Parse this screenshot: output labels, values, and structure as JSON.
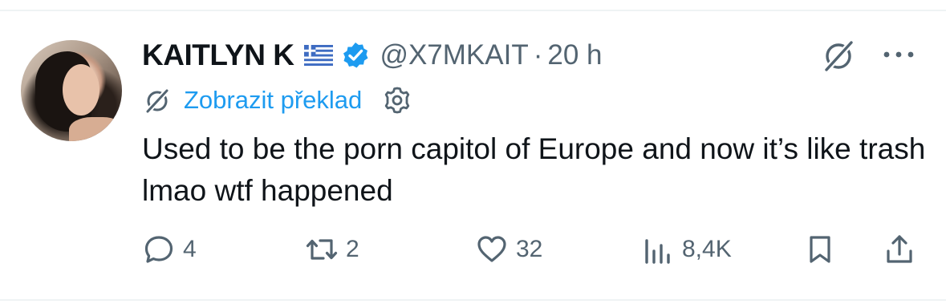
{
  "tweet": {
    "author": {
      "display_name": "KAITLYN K",
      "flag_icon": "greece-flag-icon",
      "verified_icon": "verified-badge-icon",
      "handle": "@X7MKAIT",
      "separator": "·",
      "timestamp": "20 h"
    },
    "translate": {
      "label": "Zobrazit překlad",
      "icon": "translate-icon",
      "settings_icon": "gear-icon"
    },
    "text": "Used to be the porn capitol of Europe and now it’s like trash lmao wtf happened",
    "header_icons": {
      "grok": "grok-icon",
      "more": "more-icon"
    },
    "actions": {
      "reply_count": "4",
      "retweet_count": "2",
      "like_count": "32",
      "views_count": "8,4K"
    }
  },
  "colors": {
    "text": "#0f1419",
    "secondary": "#536471",
    "accent": "#1d9bf0",
    "divider": "#eff3f4"
  }
}
